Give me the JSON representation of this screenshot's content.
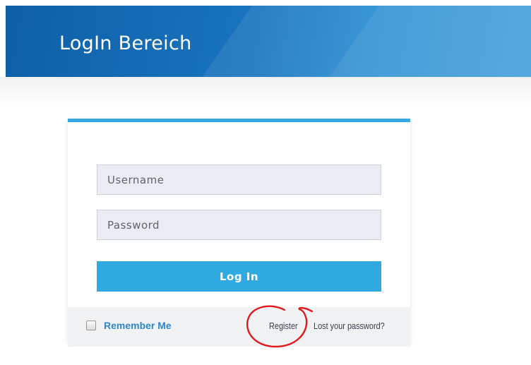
{
  "header": {
    "title": "LogIn Bereich"
  },
  "form": {
    "username_placeholder": "Username",
    "password_placeholder": "Password",
    "login_label": "Log In"
  },
  "footer": {
    "remember_label": "Remember Me",
    "register_label": "Register",
    "lost_password_label": "Lost your password?"
  },
  "colors": {
    "header": "#1873bd",
    "accent": "#2fa9e0",
    "annotation": "#e0191f"
  }
}
